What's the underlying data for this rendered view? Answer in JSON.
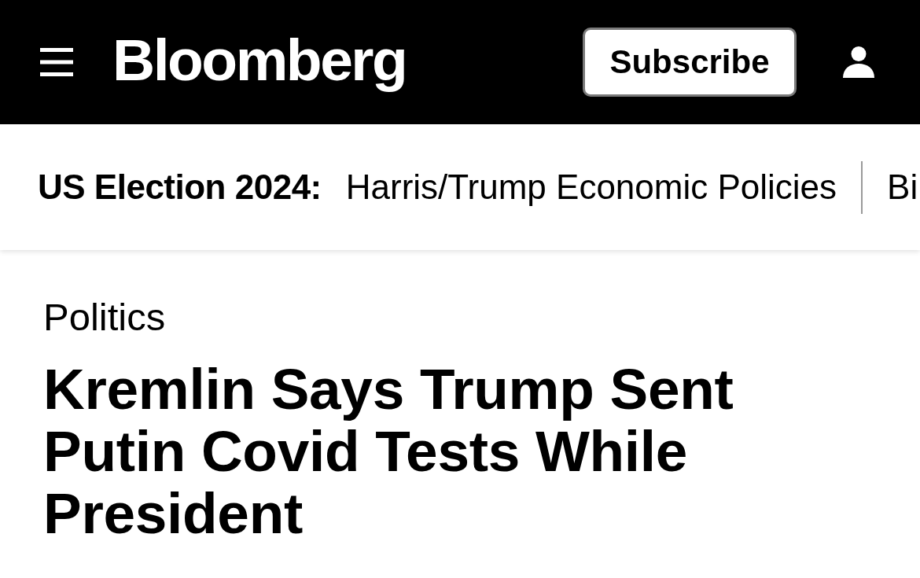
{
  "header": {
    "logo": "Bloomberg",
    "subscribe_button": "Subscribe"
  },
  "nav": {
    "label": "US Election 2024:",
    "links": [
      {
        "label": "Harris/Trump Economic Policies"
      },
      {
        "label": "Bi"
      }
    ]
  },
  "article": {
    "category": "Politics",
    "headline": "Kremlin Says Trump Sent Putin Covid Tests While President"
  }
}
